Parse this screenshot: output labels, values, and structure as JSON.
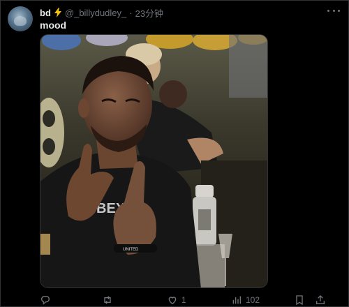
{
  "author": {
    "display_name": "bd",
    "handle": "@_billydudley_",
    "separator": "·",
    "time": "23分钟"
  },
  "tweet": {
    "text": "mood"
  },
  "media": {
    "description_icon": "photo"
  },
  "actions": {
    "reply_icon": "reply-icon",
    "retweet_icon": "retweet-icon",
    "like_count": "1",
    "views_count": "102",
    "bookmark_icon": "bookmark-icon",
    "share_icon": "share-icon"
  },
  "colors": {
    "background": "#000000",
    "text": "#e7e9ea",
    "muted": "#71767b",
    "bolt": "#f4c20d"
  }
}
